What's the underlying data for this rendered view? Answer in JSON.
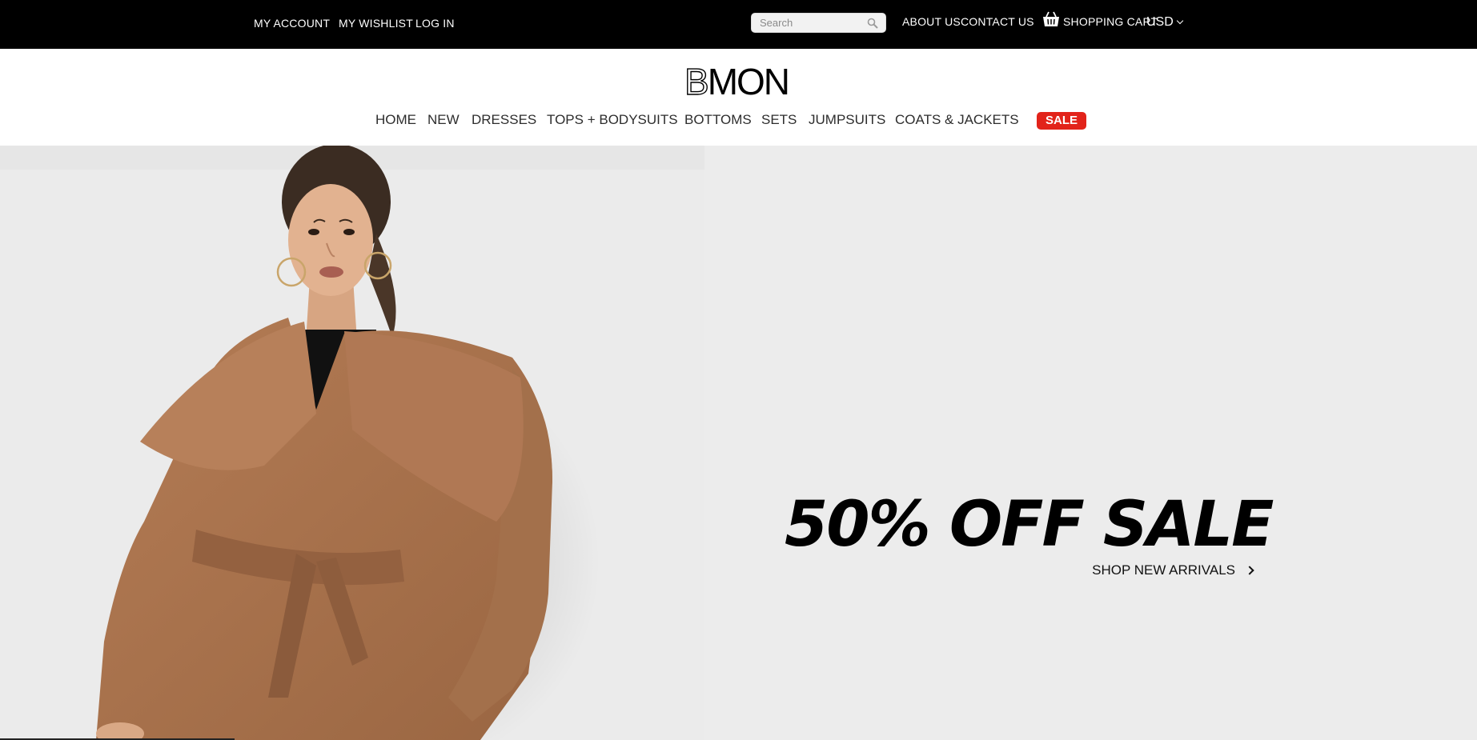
{
  "topbar": {
    "my_account": "MY ACCOUNT",
    "my_wishlist": "MY WISHLIST",
    "log_in": "LOG IN",
    "search_placeholder": "Search",
    "about_us": "ABOUT US",
    "contact_us": "CONTACT US",
    "shopping_cart": "SHOPPING CART",
    "currency": "USD"
  },
  "header": {
    "logo_first": "B",
    "logo_rest": "MON"
  },
  "nav": {
    "items": [
      "HOME",
      "NEW",
      "DRESSES",
      "TOPS + BODYSUITS",
      "BOTTOMS",
      "SETS",
      "JUMPSUITS",
      "COATS & JACKETS"
    ],
    "sale": "SALE"
  },
  "hero": {
    "title": "50% OFF SALE",
    "cta": "SHOP NEW ARRIVALS"
  },
  "colors": {
    "topbar_bg": "#000000",
    "sale_badge": "#e2231a",
    "hero_bg": "#ececec",
    "coat": "#a9724c"
  },
  "icons": [
    "search-icon",
    "shopping-basket-icon",
    "chevron-down-icon",
    "chevron-right-icon"
  ]
}
